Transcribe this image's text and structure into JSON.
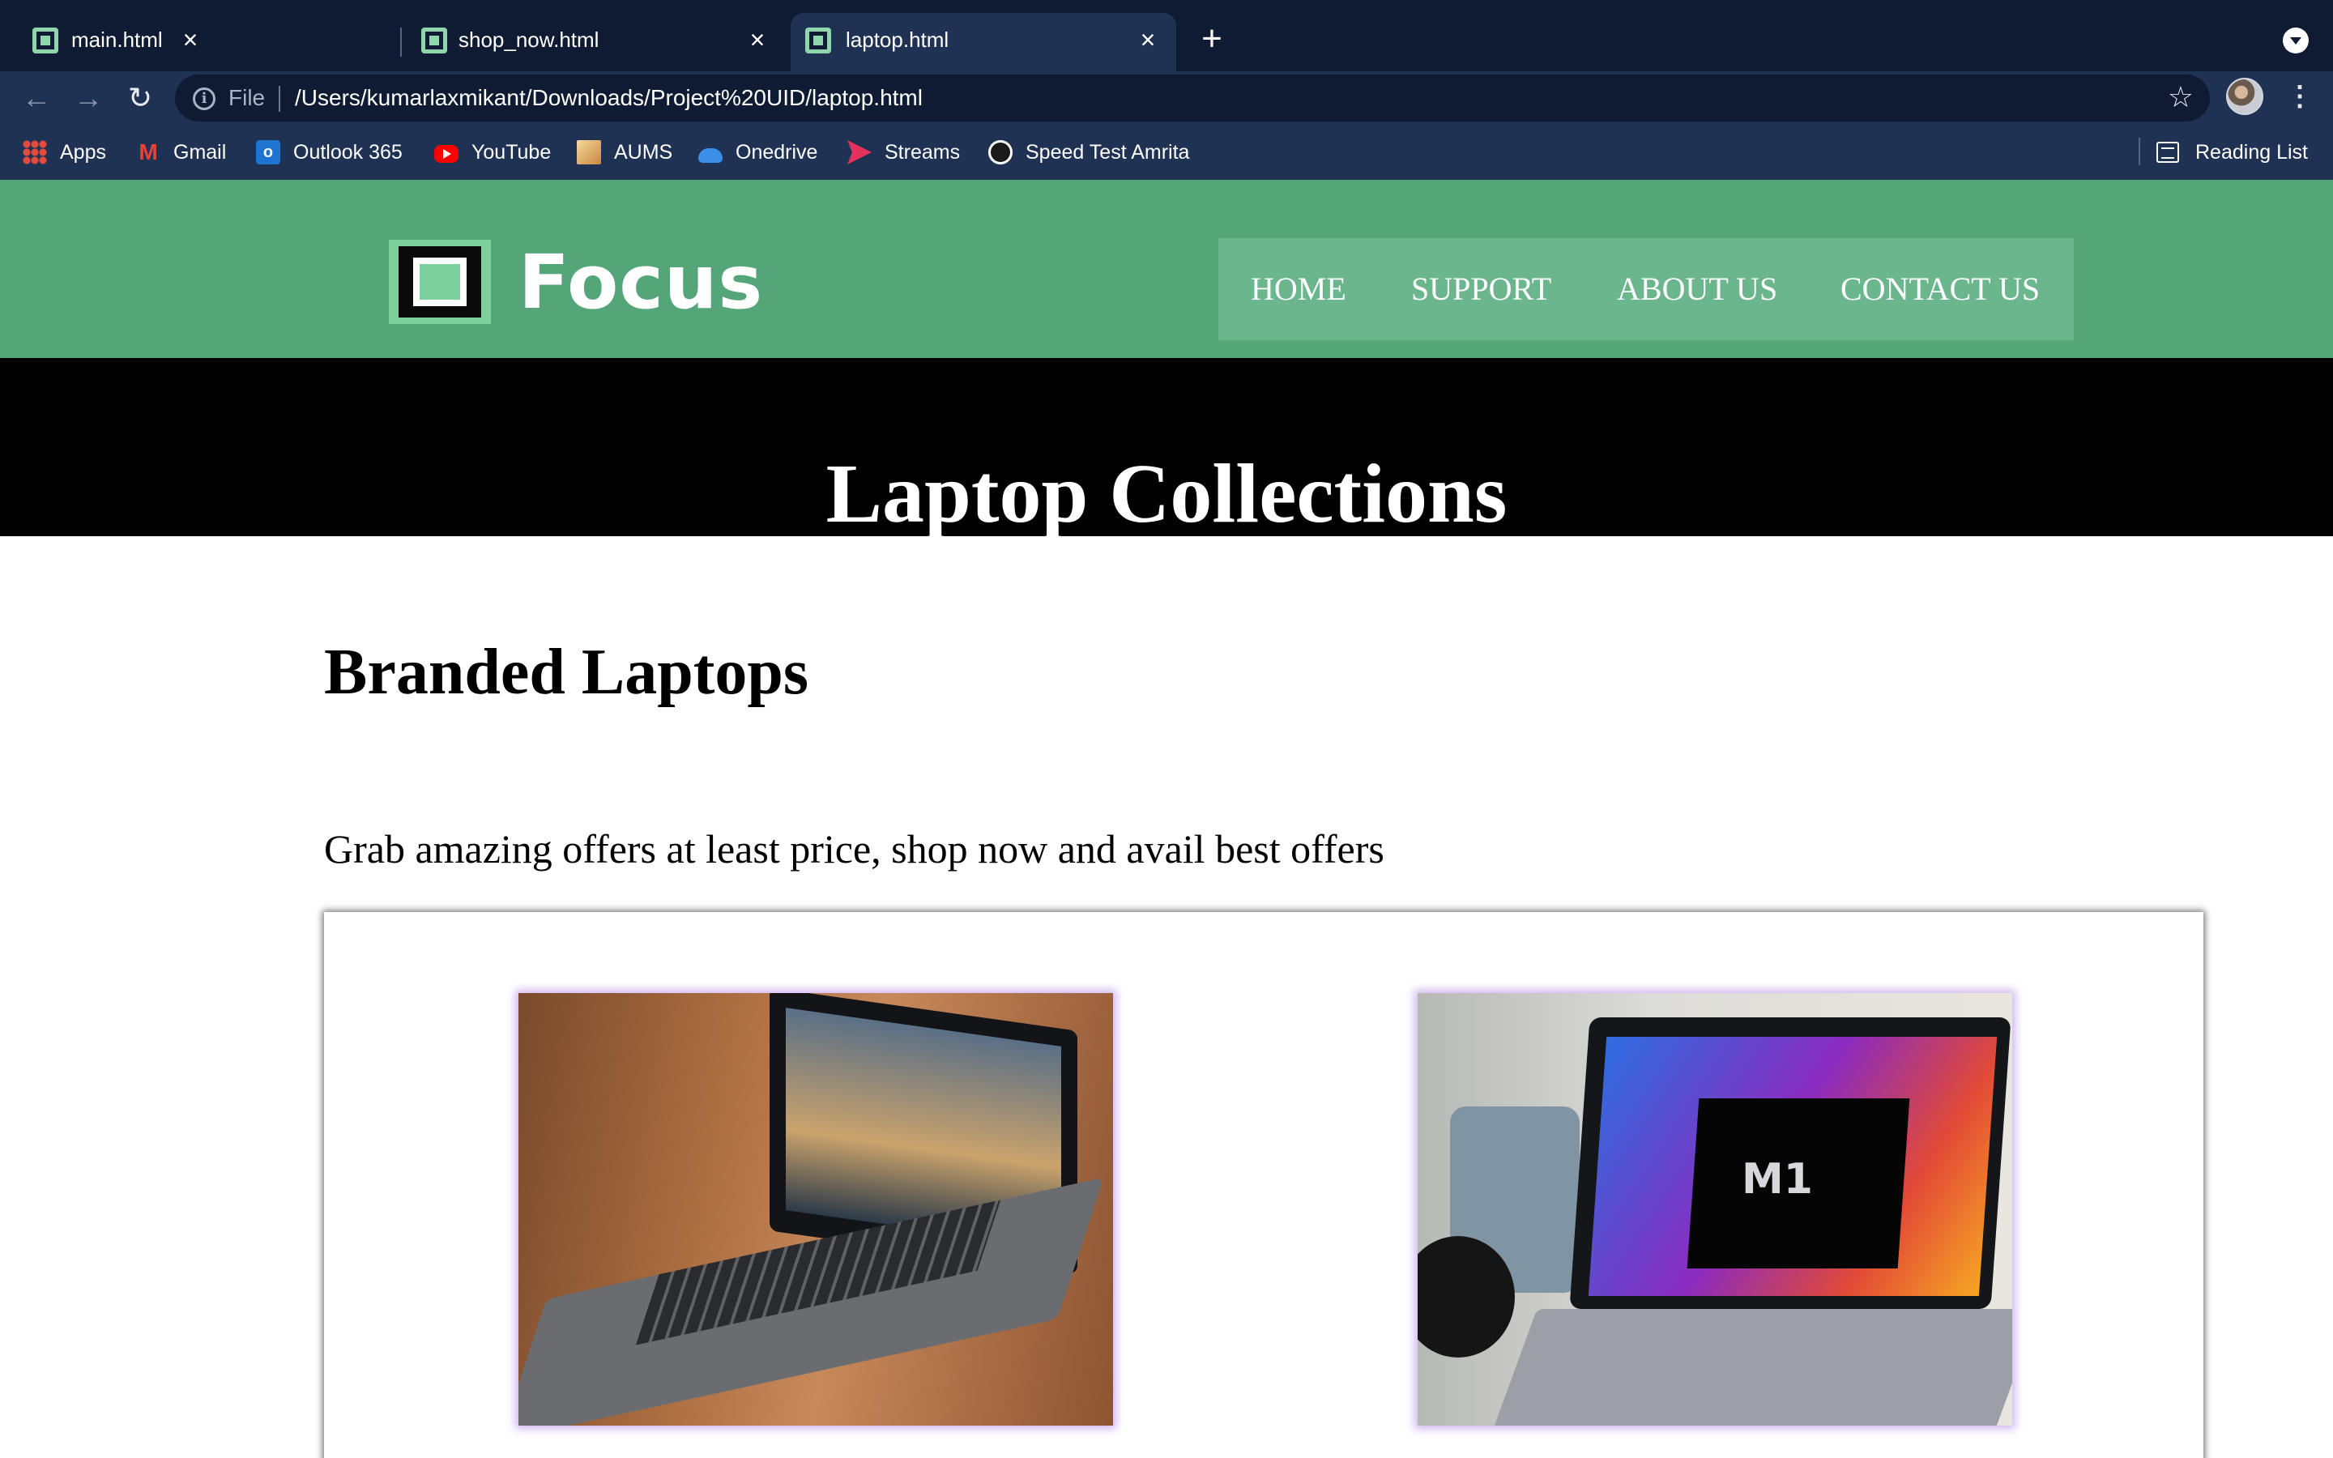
{
  "browser": {
    "tabs": [
      {
        "title": "main.html",
        "active": false
      },
      {
        "title": "shop_now.html",
        "active": false
      },
      {
        "title": "laptop.html",
        "active": true
      }
    ],
    "new_tab_icon": "plus-icon",
    "address_bar": {
      "scheme_label": "File",
      "url": "/Users/kumarlaxmikant/Downloads/Project%20UID/laptop.html"
    },
    "bookmarks": [
      {
        "label": "Apps",
        "icon": "apps-grid-icon"
      },
      {
        "label": "Gmail",
        "icon": "gmail-icon"
      },
      {
        "label": "Outlook 365",
        "icon": "outlook-icon"
      },
      {
        "label": "YouTube",
        "icon": "youtube-icon"
      },
      {
        "label": "AUMS",
        "icon": "aums-icon"
      },
      {
        "label": "Onedrive",
        "icon": "onedrive-icon"
      },
      {
        "label": "Streams",
        "icon": "streams-icon"
      },
      {
        "label": "Speed Test Amrita",
        "icon": "speedtest-icon"
      }
    ],
    "reading_list": "Reading List"
  },
  "site": {
    "logo_text": "Focus",
    "nav": [
      "HOME",
      "SUPPORT",
      "ABOUT US",
      "CONTACT US"
    ],
    "hero_title": "Laptop Collections",
    "section_title": "Branded Laptops",
    "section_subtitle": "Grab amazing offers at least price, shop now and avail best offers",
    "colors": {
      "header_green": "#54a679",
      "nav_bg": "#6bb68d",
      "hero_bg": "#000000",
      "browser_dark": "#0e1b33",
      "browser_toolbar": "#1f3254"
    }
  }
}
